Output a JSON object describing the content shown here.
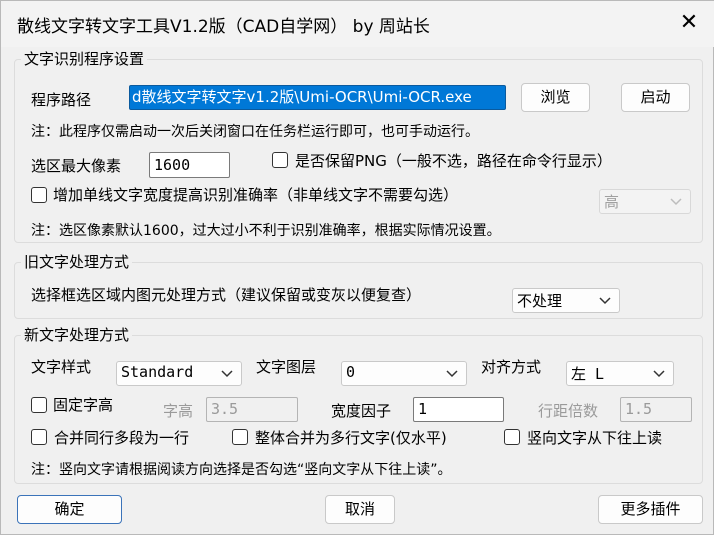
{
  "window": {
    "title": "散线文字转文字工具V1.2版（CAD自学网） by 周站长",
    "close_glyph": "✕"
  },
  "program_settings": {
    "legend": "文字识别程序设置",
    "path_label": "程序路径",
    "path_value": "d散线文字转文字v1.2版\\Umi-OCR\\Umi-OCR.exe",
    "browse_label": "浏览",
    "launch_label": "启动",
    "note1": "注：此程序仅需启动一次后关闭窗口在任务栏运行即可，也可手动运行。",
    "max_pixels_label": "选区最大像素",
    "max_pixels_value": "1600",
    "keep_png_label": "是否保留PNG（一般不选，路径在命令行显示）",
    "keep_png_checked": false,
    "increase_width_label": "增加单线文字宽度提高识别准确率（非单线文字不需要勾选）",
    "increase_width_checked": false,
    "accuracy_select": "高",
    "note2": "注：选区像素默认1600，过大过小不利于识别准确率，根据实际情况设置。"
  },
  "old_text": {
    "legend": "旧文字处理方式",
    "method_label": "选择框选区域内图元处理方式（建议保留或变灰以便复查）",
    "method_value": "不处理"
  },
  "new_text": {
    "legend": "新文字处理方式",
    "style_label": "文字样式",
    "style_value": "Standard",
    "layer_label": "文字图层",
    "layer_value": "0",
    "align_label": "对齐方式",
    "align_value": "左 L",
    "fixed_height_label": "固定字高",
    "fixed_height_checked": false,
    "height_label": "字高",
    "height_value": "3.5",
    "width_factor_label": "宽度因子",
    "width_factor_value": "1",
    "line_spacing_label": "行距倍数",
    "line_spacing_value": "1.5",
    "merge_lines_label": "合并同行多段为一行",
    "merge_multiline_label": "整体合并为多行文字(仅水平)",
    "vertical_label": "竖向文字从下往上读",
    "note3": "注：竖向文字请根据阅读方向选择是否勾选“竖向文字从下往上读”。"
  },
  "footer": {
    "ok_label": "确定",
    "cancel_label": "取消",
    "more_label": "更多插件"
  },
  "icons": {
    "close": "close-icon",
    "chevron": "chevron-down-icon"
  }
}
